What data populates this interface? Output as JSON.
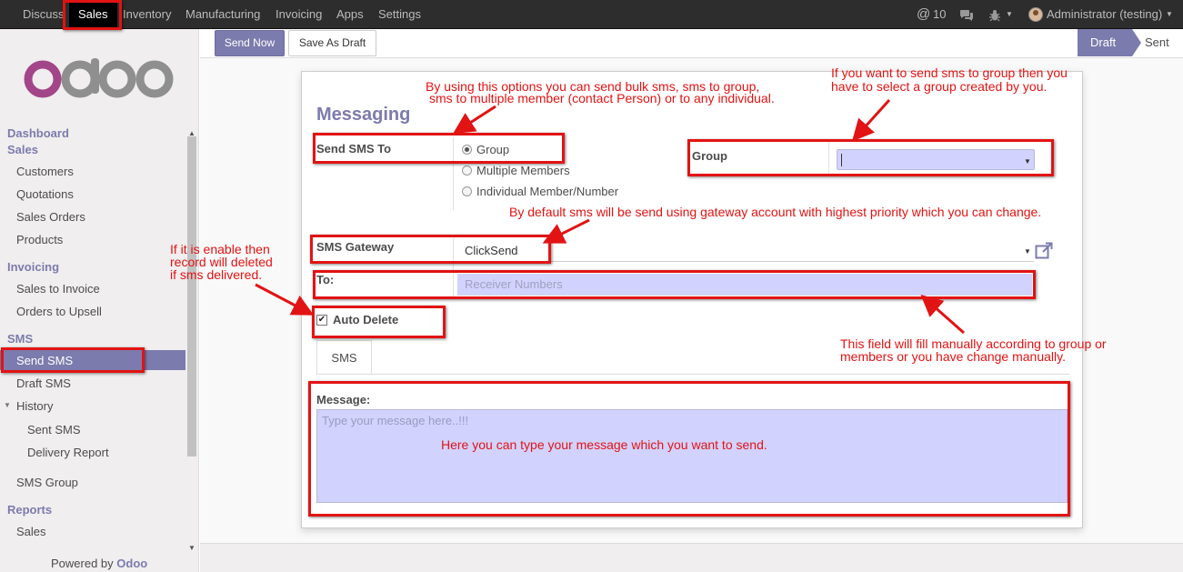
{
  "topbar": {
    "menus": [
      "Discuss",
      "Sales",
      "Inventory",
      "Manufacturing",
      "Invoicing",
      "Apps",
      "Settings"
    ],
    "active_menu": "Sales",
    "mentions_count": "10",
    "user": "Administrator (testing)"
  },
  "sidebar": {
    "brand": "odoo",
    "sections": {
      "dashboard": "Dashboard",
      "sales": "Sales",
      "invoicing": "Invoicing",
      "sms": "SMS",
      "reports": "Reports"
    },
    "items": {
      "customers": "Customers",
      "quotations": "Quotations",
      "sales_orders": "Sales Orders",
      "products": "Products",
      "sales_to_invoice": "Sales to Invoice",
      "orders_to_upsell": "Orders to Upsell",
      "send_sms": "Send SMS",
      "draft_sms": "Draft SMS",
      "history": "History",
      "sent_sms": "Sent SMS",
      "delivery_report": "Delivery Report",
      "sms_group": "SMS Group",
      "reports_sales": "Sales"
    },
    "powered_by": "Powered by",
    "powered_brand": "Odoo"
  },
  "controls": {
    "send_now": "Send Now",
    "save_as_draft": "Save As Draft",
    "status_draft": "Draft",
    "status_sent": "Sent"
  },
  "form": {
    "title": "Messaging",
    "send_sms_to_label": "Send SMS To",
    "options": [
      "Group",
      "Multiple Members",
      "Individual Member/Number"
    ],
    "selected_option": "Group",
    "group_label": "Group",
    "group_value": "",
    "sms_gateway_label": "SMS Gateway",
    "sms_gateway_value": "ClickSend",
    "to_label": "To:",
    "to_placeholder": "Receiver Numbers",
    "auto_delete_label": "Auto Delete",
    "auto_delete_checked": true,
    "tab_sms": "SMS",
    "message_label": "Message:",
    "message_placeholder": "Type your message here..!!!"
  },
  "annotations": {
    "bulk_1": "By using this options you can send bulk sms, sms to group,",
    "bulk_2": "sms to multiple member (contact Person) or to any individual.",
    "group_1": "If you want to send sms to group then you",
    "group_2": "have to select a group created by you.",
    "gateway": "By default sms will be send using gateway account with highest priority which you can change.",
    "autodel_1": "If it is enable then",
    "autodel_2": "record will deleted",
    "autodel_3": "if sms delivered.",
    "to_1": "This field will fill manually according to group or",
    "to_2": "members or you have change manually.",
    "message": "Here you can type your message which you want to send."
  },
  "colors": {
    "brand": "#7c7bad",
    "annotation_red": "#e21313",
    "input_fill": "#d2d2ff",
    "topbar": "#2d2d2d"
  }
}
